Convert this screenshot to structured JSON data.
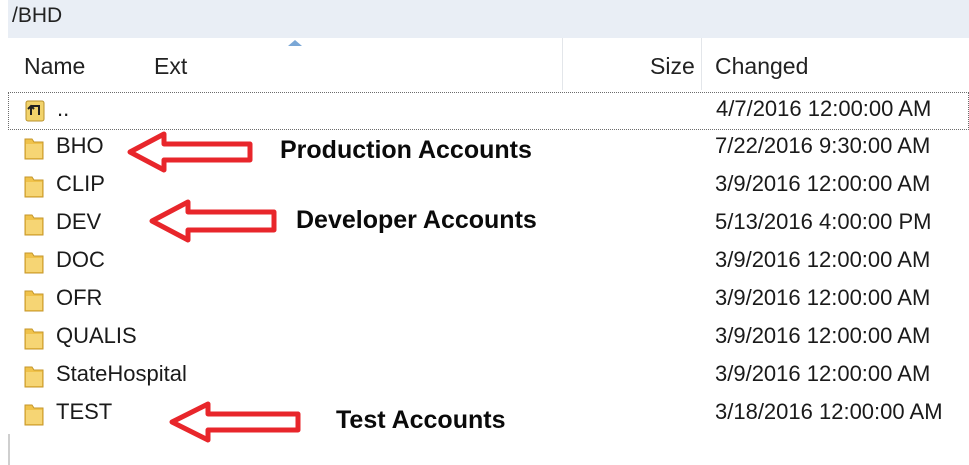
{
  "path": "/BHD",
  "columns": {
    "name": "Name",
    "ext": "Ext",
    "size": "Size",
    "changed": "Changed"
  },
  "rows": [
    {
      "name": "..",
      "changed": "4/7/2016 12:00:00 AM",
      "icon": "parent-directory-icon"
    },
    {
      "name": "BHO",
      "changed": "7/22/2016 9:30:00 AM",
      "icon": "folder-icon"
    },
    {
      "name": "CLIP",
      "changed": "3/9/2016 12:00:00 AM",
      "icon": "folder-icon"
    },
    {
      "name": "DEV",
      "changed": "5/13/2016 4:00:00 PM",
      "icon": "folder-icon"
    },
    {
      "name": "DOC",
      "changed": "3/9/2016 12:00:00 AM",
      "icon": "folder-icon"
    },
    {
      "name": "OFR",
      "changed": "3/9/2016 12:00:00 AM",
      "icon": "folder-icon"
    },
    {
      "name": "QUALIS",
      "changed": "3/9/2016 12:00:00 AM",
      "icon": "folder-icon"
    },
    {
      "name": "StateHospital",
      "changed": "3/9/2016 12:00:00 AM",
      "icon": "folder-icon"
    },
    {
      "name": "TEST",
      "changed": "3/18/2016 12:00:00 AM",
      "icon": "folder-icon"
    }
  ],
  "annotations": {
    "production": "Production Accounts",
    "developer": "Developer Accounts",
    "test": "Test Accounts"
  },
  "colors": {
    "arrow": "#e8262b",
    "folder": "#e9b93a",
    "header_bg": "#e9eef5"
  }
}
